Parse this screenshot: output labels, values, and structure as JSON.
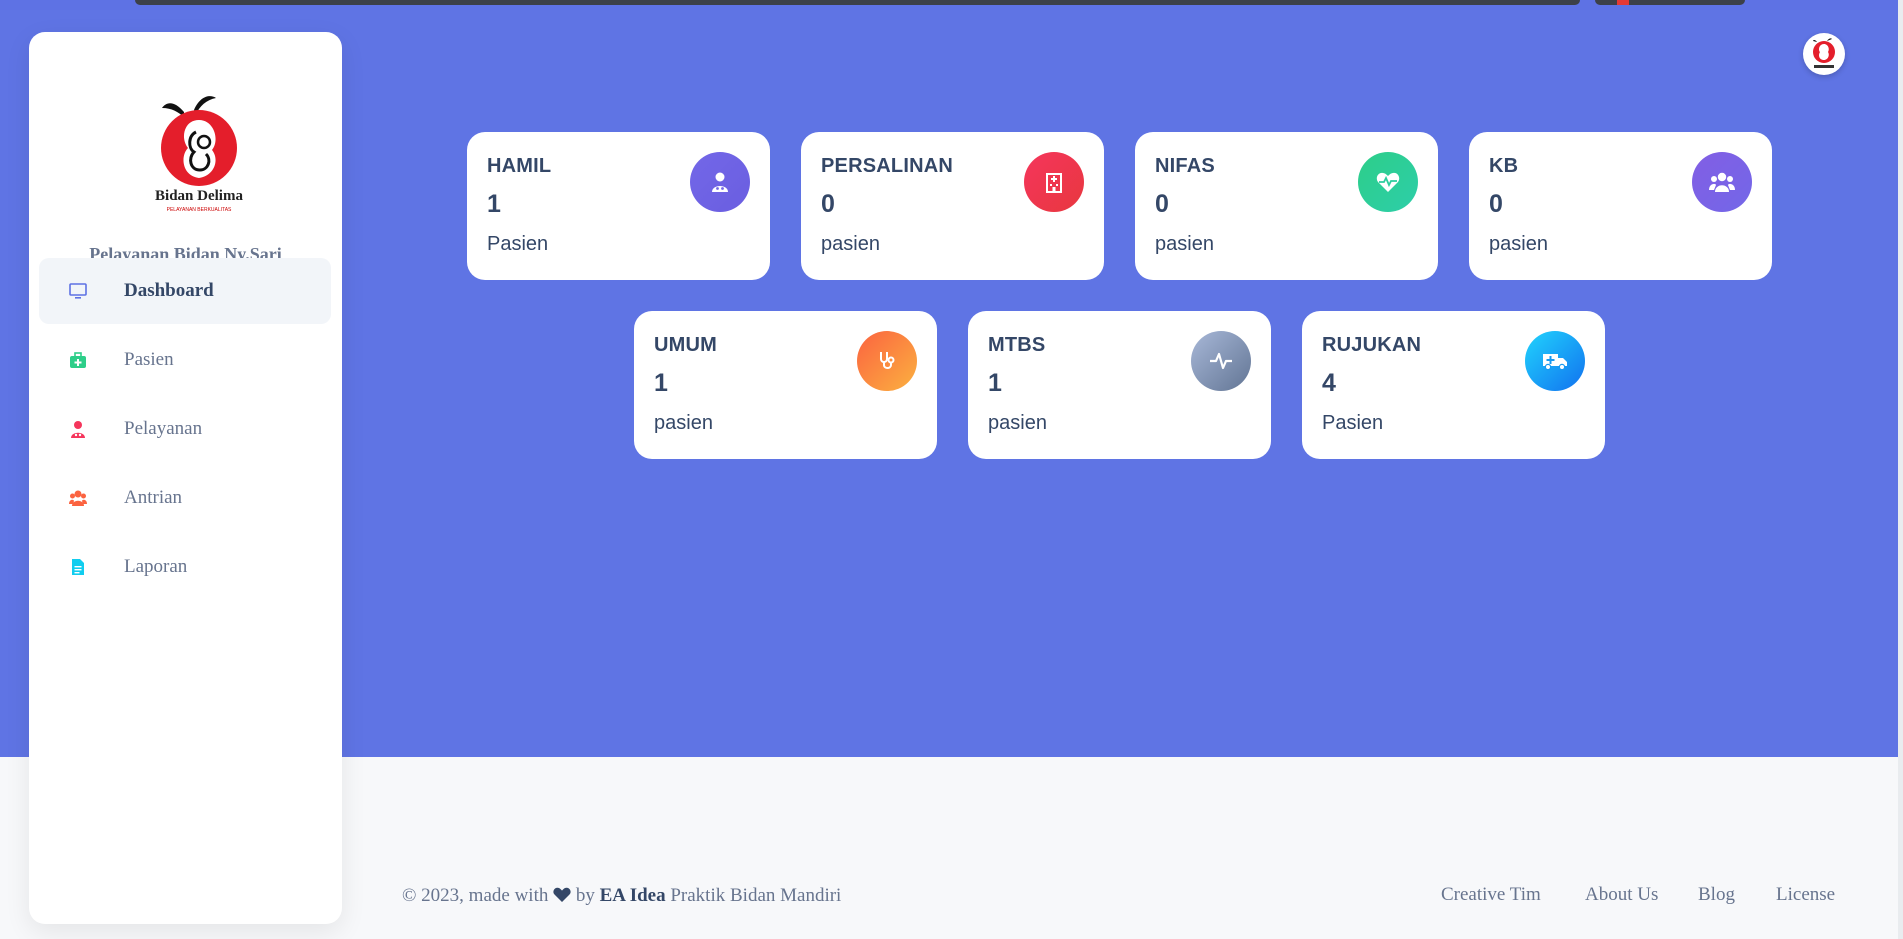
{
  "sidebar": {
    "brand": "Pelayanan Bidan Ny.Sari",
    "logo_text": "Bidan Delima",
    "logo_subtext": "PELAYANAN BERKUALITAS",
    "items": [
      {
        "label": "Dashboard",
        "icon": "monitor-icon",
        "active": true
      },
      {
        "label": "Pasien",
        "icon": "medkit-icon"
      },
      {
        "label": "Pelayanan",
        "icon": "doctor-icon"
      },
      {
        "label": "Antrian",
        "icon": "users-icon"
      },
      {
        "label": "Laporan",
        "icon": "document-icon"
      }
    ]
  },
  "cards": [
    {
      "title": "HAMIL",
      "value": "1",
      "unit": "Pasien",
      "icon": "user-doctor-icon",
      "color": "#7367e8"
    },
    {
      "title": "PERSALINAN",
      "value": "0",
      "unit": "pasien",
      "icon": "hospital-icon",
      "color": "#ea3d4f"
    },
    {
      "title": "NIFAS",
      "value": "0",
      "unit": "pasien",
      "icon": "heart-pulse-icon",
      "color": "#2dce9e"
    },
    {
      "title": "KB",
      "value": "0",
      "unit": "pasien",
      "icon": "users-icon",
      "color": "#7b5ee6"
    },
    {
      "title": "UMUM",
      "value": "1",
      "unit": "pasien",
      "icon": "stethoscope-icon",
      "color": "#fb7d3a"
    },
    {
      "title": "MTBS",
      "value": "1",
      "unit": "pasien",
      "icon": "wave-pulse-icon",
      "color": "#8592ad"
    },
    {
      "title": "RUJUKAN",
      "value": "4",
      "unit": "Pasien",
      "icon": "ambulance-icon",
      "color": "#11a0f0"
    }
  ],
  "footer": {
    "copyright": "© 2023, made with",
    "by": "by",
    "author": "EA Idea",
    "suffix": "Praktik Bidan Mandiri",
    "links": [
      "Creative Tim",
      "About Us",
      "Blog",
      "License"
    ]
  },
  "colors": {
    "hero": "#5f74e4",
    "background": "#f7f8fa"
  }
}
